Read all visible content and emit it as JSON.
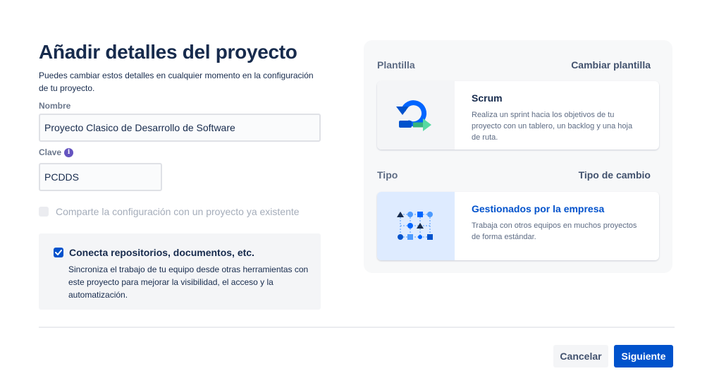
{
  "header": {
    "title": "Añadir detalles del proyecto",
    "subtitle": "Puedes cambiar estos detalles en cualquier momento en la configuración de tu proyecto."
  },
  "form": {
    "name_label": "Nombre",
    "name_value": "Proyecto Clasico de Desarrollo de Software",
    "key_label": "Clave",
    "key_info_icon": "info-icon",
    "key_value": "PCDDS",
    "share_config_label": "Comparte la configuración con un proyecto ya existente",
    "share_config_checked": false,
    "share_config_disabled": true,
    "connect": {
      "checked": true,
      "title": "Conecta repositorios, documentos, etc.",
      "description": "Sincroniza el trabajo de tu equipo desde otras herramientas con este proyecto para mejorar la visibilidad, el acceso y la automatización."
    }
  },
  "side_panel": {
    "template_heading": "Plantilla",
    "change_template_label": "Cambiar plantilla",
    "template_card": {
      "icon": "scrum-icon",
      "title": "Scrum",
      "description": "Realiza un sprint hacia los objetivos de tu proyecto con un tablero, un backlog y una hoja de ruta."
    },
    "type_heading": "Tipo",
    "change_type_label": "Tipo de cambio",
    "type_card": {
      "icon": "company-managed-icon",
      "title": "Gestionados por la empresa",
      "description": "Trabaja con otros equipos en muchos proyectos de forma estándar."
    }
  },
  "footer": {
    "cancel_label": "Cancelar",
    "next_label": "Siguiente"
  },
  "colors": {
    "primary": "#0052cc",
    "text": "#172b4d",
    "subtle_text": "#5e6c84",
    "info_icon": "#6554c0",
    "panel_bg": "#f7f8f9"
  }
}
